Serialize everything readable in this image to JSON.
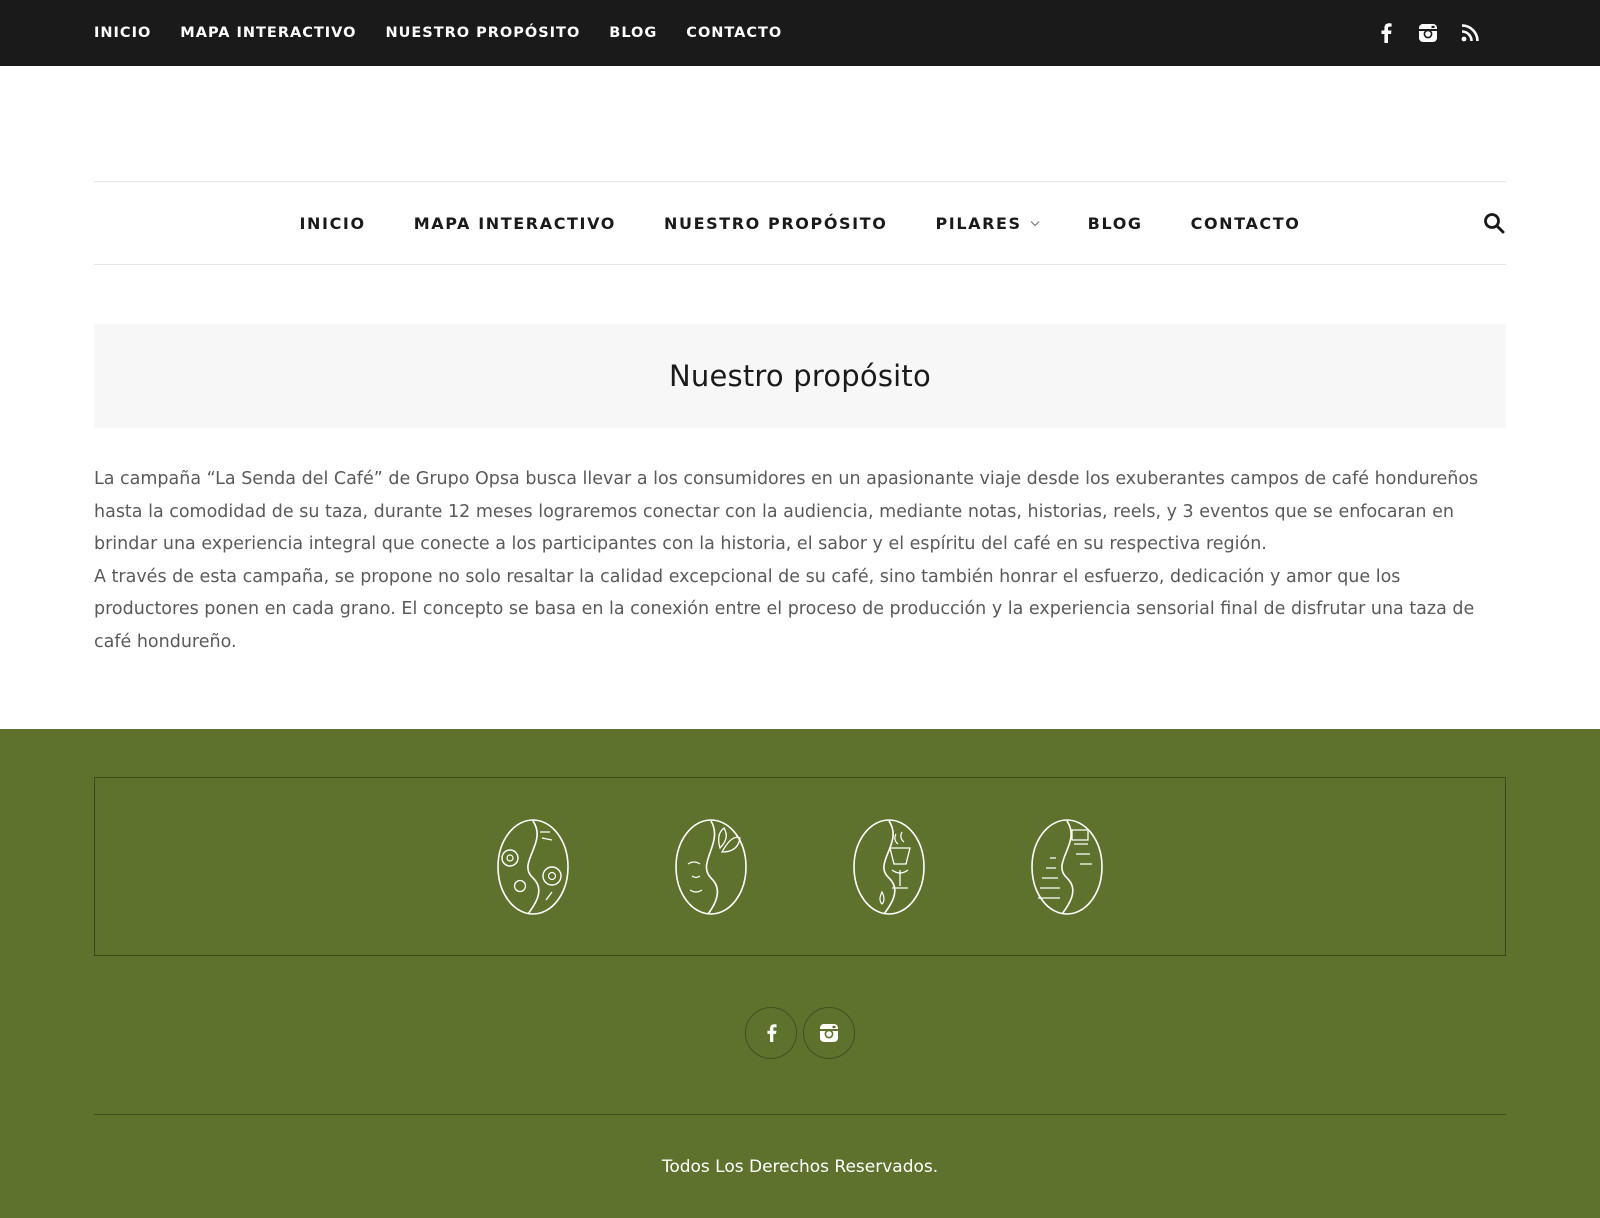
{
  "topbar": {
    "nav": [
      "INICIO",
      "MAPA INTERACTIVO",
      "NUESTRO PROPÓSITO",
      "BLOG",
      "CONTACTO"
    ],
    "social_icons": [
      "facebook-icon",
      "instagram-icon",
      "rss-icon"
    ]
  },
  "mainnav": {
    "items": [
      "INICIO",
      "MAPA INTERACTIVO",
      "NUESTRO PROPÓSITO",
      "PILARES",
      "BLOG",
      "CONTACTO"
    ],
    "dropdown_item": "PILARES",
    "search_icon": "search-icon"
  },
  "page": {
    "title": "Nuestro propósito",
    "paragraph_1": "La campaña “La Senda del Café” de Grupo Opsa busca llevar a los consumidores en un apasionante viaje desde los exuberantes campos de café hondureños hasta la comodidad de su taza, durante 12 meses lograremos conectar con la audiencia, mediante notas, historias, reels, y 3 eventos que se enfocaran en brindar una experiencia integral que conecte a los participantes con la historia, el sabor y el espíritu del café en su respectiva región.",
    "paragraph_2": "A través de esta campaña, se propone no solo resaltar la calidad excepcional de su café, sino también honrar el esfuerzo, dedicación y amor que los productores ponen en cada grano. El concepto se basa en la conexión entre el proceso de producción y la experiencia sensorial final de disfrutar una taza de café hondureño."
  },
  "footer": {
    "pillar_icons": [
      "coffee-bean-gears-icon",
      "coffee-bean-woman-icon",
      "coffee-bean-cup-icon",
      "coffee-bean-pyramid-icon"
    ],
    "social_icons": [
      "facebook-icon",
      "instagram-icon"
    ],
    "copyright": "Todos Los Derechos Reservados."
  },
  "colors": {
    "topbar_bg": "#1a1a1a",
    "footer_bg": "#5e722d",
    "title_box_bg": "#f7f7f7"
  }
}
